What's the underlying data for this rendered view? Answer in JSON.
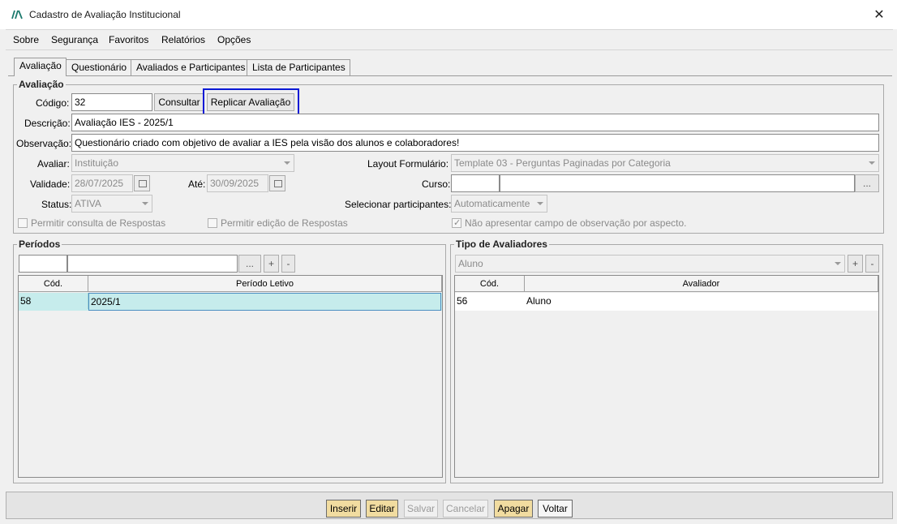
{
  "window": {
    "title": "Cadastro de Avaliação Institucional",
    "close_glyph": "✕"
  },
  "menu": [
    {
      "label": "Sobre"
    },
    {
      "label": "Segurança"
    },
    {
      "label": "Favoritos"
    },
    {
      "label": "Relatórios"
    },
    {
      "label": "Opções"
    }
  ],
  "tabs": [
    "Avaliação",
    "Questionário",
    "Avaliados e Participantes",
    "Lista de Participantes"
  ],
  "avaliacao": {
    "group_title": "Avaliação",
    "codigo_label": "Código:",
    "codigo_value": "32",
    "consultar_label": "Consultar",
    "replicar_label": "Replicar Avaliação",
    "descricao_label": "Descrição:",
    "descricao_value": "Avaliação IES - 2025/1",
    "observacao_label": "Observação:",
    "observacao_value": "Questionário criado com objetivo de avaliar a IES pela visão dos alunos e colaboradores!",
    "avaliar_label": "Avaliar:",
    "avaliar_value": "Instituição",
    "layout_label": "Layout Formulário:",
    "layout_value": "Template 03 - Perguntas Paginadas por Categoria",
    "validade_label": "Validade:",
    "validade_value": "28/07/2025",
    "ate_label": "Até:",
    "ate_value": "30/09/2025",
    "curso_label": "Curso:",
    "curso_code": "",
    "curso_name": "",
    "curso_btn": "...",
    "status_label": "Status:",
    "status_value": "ATIVA",
    "selecionar_label": "Selecionar participantes:",
    "selecionar_value": "Automaticamente",
    "chk_consulta": {
      "label": "Permitir consulta de Respostas",
      "checked": false
    },
    "chk_edicao": {
      "label": "Permitir edição de Respostas",
      "checked": false
    },
    "chk_observacao": {
      "label": "Não apresentar campo de observação por aspecto.",
      "checked": true
    }
  },
  "periodos": {
    "group_title": "Períodos",
    "btn_more": "...",
    "btn_add": "+",
    "btn_remove": "-",
    "columns": [
      "Cód.",
      "Período Letivo"
    ],
    "rows": [
      {
        "cod": "58",
        "periodo": "2025/1"
      }
    ]
  },
  "avaliadores": {
    "group_title": "Tipo de Avaliadores",
    "select_value": "Aluno",
    "btn_add": "+",
    "btn_remove": "-",
    "columns": [
      "Cód.",
      "Avaliador"
    ],
    "rows": [
      {
        "cod": "56",
        "avaliador": "Aluno"
      }
    ]
  },
  "actions": {
    "inserir": "Inserir",
    "editar": "Editar",
    "salvar": "Salvar",
    "cancelar": "Cancelar",
    "apagar": "Apagar",
    "voltar": "Voltar"
  },
  "colors": {
    "highlight": "#0a19d6",
    "selected_row": "#c6ecec",
    "gold_button": "#f1dca0"
  }
}
